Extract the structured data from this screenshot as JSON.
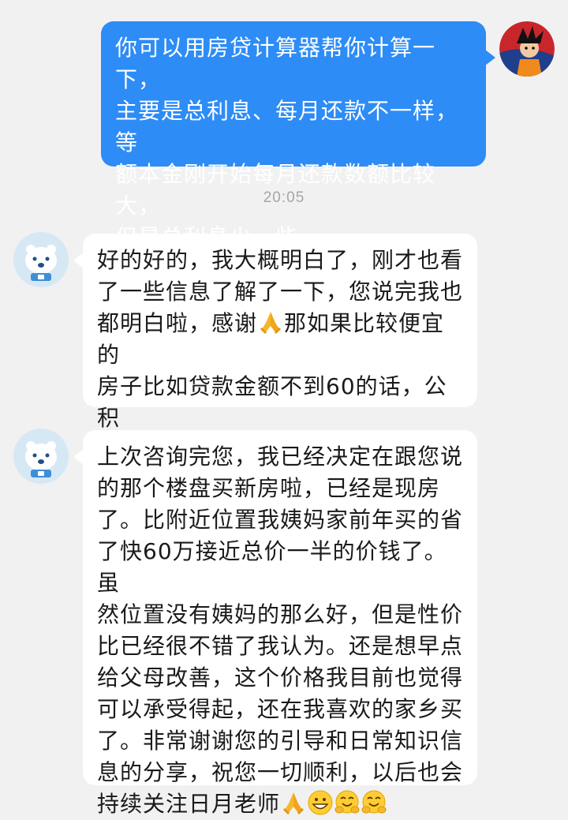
{
  "chat": {
    "messages": [
      {
        "sender": "self",
        "text": "你可以用房贷计算器帮你计算一下，\n主要是总利息、每月还款不一样，等\n额本金刚开始每月还款数额比较大，\n但是总利息少一些"
      },
      {
        "sender": "other",
        "text_before_pray": "好的好的，我大概明白了，刚才也看\n了一些信息了解了一下，您说完我也\n都明白啦，感谢",
        "text_after_pray": "那如果比较便宜的\n房子比如贷款金额不到60的话，公积\n金贷款和商业贷款您有推荐吗？"
      },
      {
        "sender": "other",
        "text": "上次咨询完您，我已经决定在跟您说\n的那个楼盘买新房啦，已经是现房\n了。比附近位置我姨妈家前年买的省\n了快60万接近总价一半的价钱了。虽\n然位置没有姨妈的那么好，但是性价\n比已经很不错了我认为。还是想早点\n给父母改善，这个价格我目前也觉得\n可以承受得起，还在我喜欢的家乡买\n了。非常谢谢您的引导和日常知识信\n息的分享，祝您一切顺利，以后也会\n持续关注日月老师",
        "trailing_emojis": [
          "folded-hands",
          "grinning-face",
          "hugging-face",
          "hugging-face"
        ]
      }
    ],
    "timestamp": "20:05"
  },
  "colors": {
    "outgoing_bubble": "#2d8cf6",
    "incoming_bubble": "#ffffff",
    "background": "#f1f1f1"
  },
  "icons": {
    "self_avatar": "cartoon-character-avatar",
    "bot_avatar": "polar-bear-avatar"
  }
}
